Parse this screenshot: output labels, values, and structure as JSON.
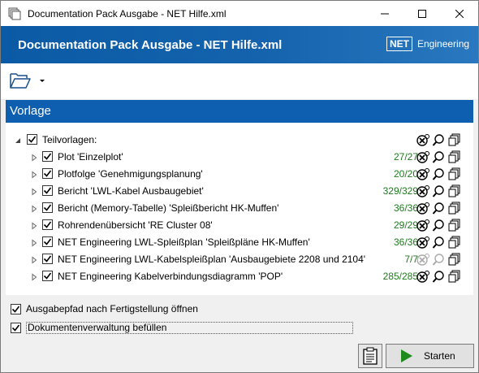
{
  "window": {
    "title": "Documentation Pack Ausgabe - NET Hilfe.xml"
  },
  "banner": {
    "title": "Documentation Pack Ausgabe - NET Hilfe.xml",
    "logo_mark": "NET",
    "logo_text": "Engineering"
  },
  "section": {
    "title": "Vorlage"
  },
  "tree": {
    "root_label": "Teilvorlagen:",
    "items": [
      {
        "label": "Plot 'Einzelplot'",
        "count": "27/27",
        "checked": true
      },
      {
        "label": "Plotfolge 'Genehmigungsplanung'",
        "count": "20/20",
        "checked": true
      },
      {
        "label": "Bericht 'LWL-Kabel Ausbaugebiet'",
        "count": "329/329",
        "checked": true
      },
      {
        "label": "Bericht (Memory-Tabelle) 'Spleißbericht HK-Muffen'",
        "count": "36/36",
        "checked": true
      },
      {
        "label": "Rohrendenübersicht 'RE Cluster 08'",
        "count": "29/29",
        "checked": true
      },
      {
        "label": "NET Engineering LWL-Spleißplan 'Spleißpläne HK-Muffen'",
        "count": "36/36",
        "checked": true
      },
      {
        "label": "NET Engineering LWL-Kabelspleißplan 'Ausbaugebiete 2208 und 2104'",
        "count": "7/7",
        "checked": true
      },
      {
        "label": "NET Engineering Kabelverbindungsdiagramm 'POP'",
        "count": "285/285",
        "checked": true
      }
    ]
  },
  "options": {
    "open_output": "Ausgabepfad nach Fertigstellung öffnen",
    "fill_docmgmt": "Dokumentenverwaltung befüllen"
  },
  "buttons": {
    "start": "Starten"
  },
  "colors": {
    "accent": "#0e5fb0",
    "count_green": "#1f7a1f",
    "play_green": "#1e8a1e"
  }
}
